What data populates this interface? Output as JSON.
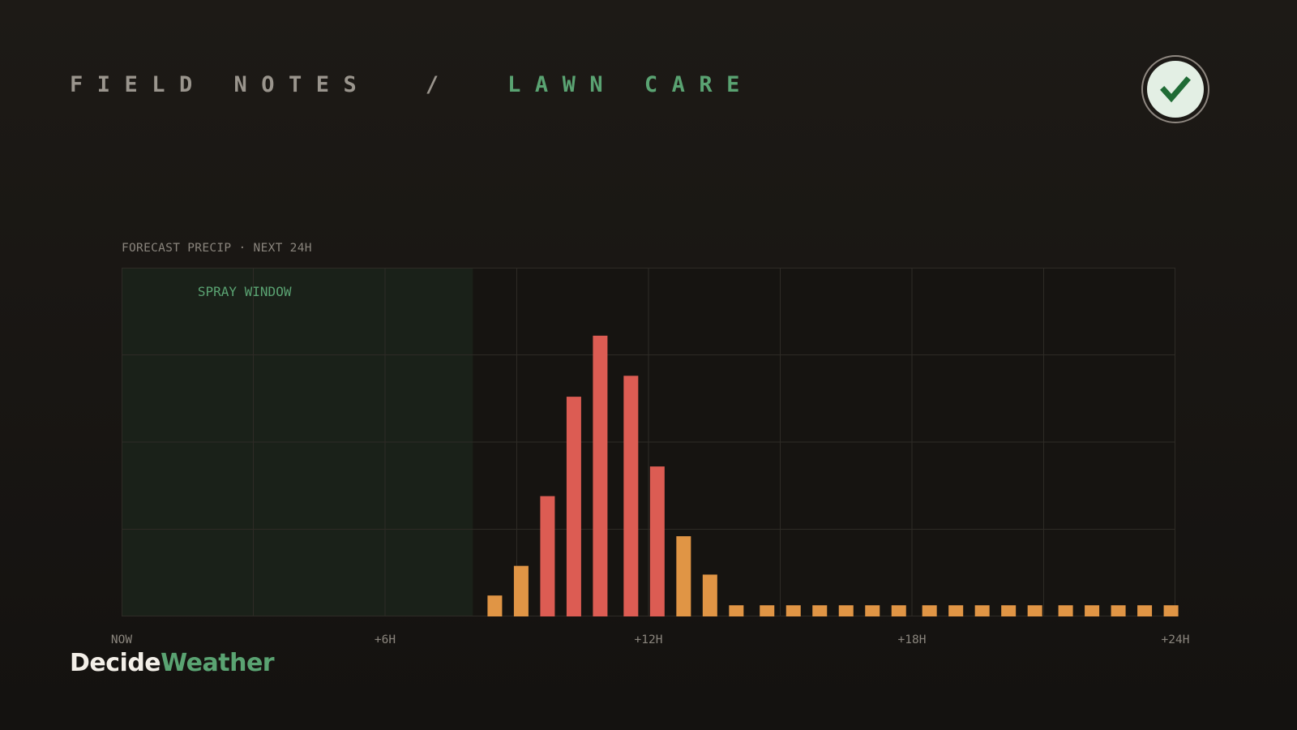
{
  "header": {
    "section": "FIELD NOTES",
    "separator": "/",
    "topic": "LAWN CARE"
  },
  "status_badge": {
    "icon": "check-icon",
    "ring_color": "#8e8780",
    "fill_color": "#e3efe4",
    "check_color": "#1f6b35"
  },
  "brand": {
    "part1": "Decide",
    "part2": "Weather"
  },
  "colors": {
    "background": "#1a1714",
    "accent_green": "#5aa372",
    "window_fill": "#1a2119",
    "bar_moderate": "#e09545",
    "bar_heavy": "#dc5c53",
    "grid": "#2e2b26"
  },
  "chart_data": {
    "type": "bar",
    "title": "FORECAST PRECIP · NEXT 24H",
    "xlabel": "",
    "ylabel": "",
    "x_ticks": [
      {
        "hour": 0,
        "label": "NOW"
      },
      {
        "hour": 6,
        "label": "+6H"
      },
      {
        "hour": 12,
        "label": "+12H"
      },
      {
        "hour": 18,
        "label": "+18H"
      },
      {
        "hour": 24,
        "label": "+24H"
      }
    ],
    "xlim": [
      0,
      24
    ],
    "ylim": [
      0,
      100
    ],
    "grid": true,
    "annotation": {
      "label": "SPRAY WINDOW",
      "start_hour": 0,
      "end_hour": 8
    },
    "series": [
      {
        "hours": [
          8.5,
          9.1,
          9.7,
          10.3,
          10.9,
          11.6,
          12.2,
          12.8,
          13.4,
          14.0,
          14.7,
          15.3,
          15.9,
          16.5,
          17.1,
          17.7,
          18.4,
          19.0,
          19.6,
          20.2,
          20.8,
          21.5,
          22.1,
          22.7,
          23.3,
          23.9
        ],
        "values": [
          6,
          14.5,
          34.5,
          63,
          80.5,
          69,
          43,
          23,
          12,
          3.2,
          3.2,
          3.2,
          3.2,
          3.2,
          3.2,
          3.2,
          3.2,
          3.2,
          3.2,
          3.2,
          3.2,
          3.2,
          3.2,
          3.2,
          3.2,
          3.2
        ],
        "levels": [
          "moderate",
          "moderate",
          "heavy",
          "heavy",
          "heavy",
          "heavy",
          "heavy",
          "moderate",
          "moderate",
          "moderate",
          "moderate",
          "moderate",
          "moderate",
          "moderate",
          "moderate",
          "moderate",
          "moderate",
          "moderate",
          "moderate",
          "moderate",
          "moderate",
          "moderate",
          "moderate",
          "moderate",
          "moderate",
          "moderate"
        ]
      }
    ]
  }
}
